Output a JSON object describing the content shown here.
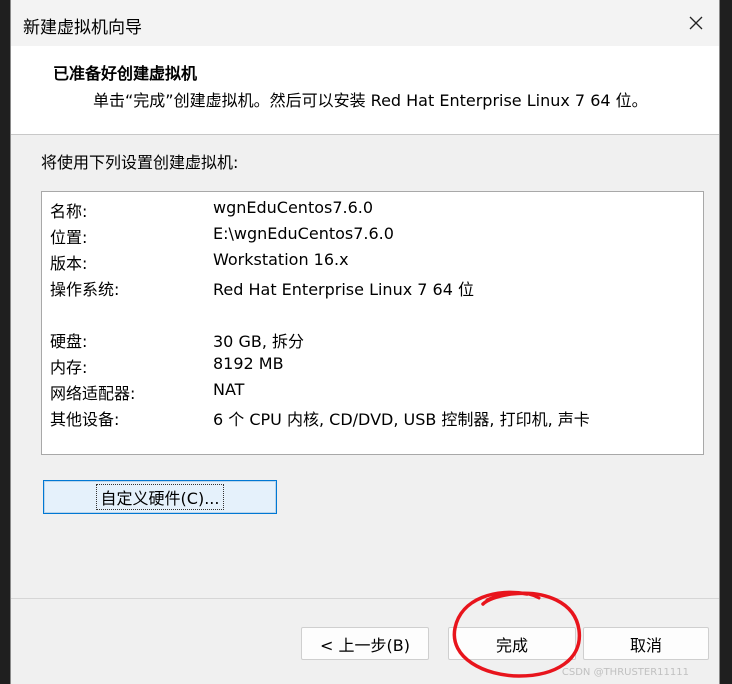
{
  "window": {
    "title": "新建虚拟机向导"
  },
  "header": {
    "title": "已准备好创建虚拟机",
    "subtitle": "单击“完成”创建虚拟机。然后可以安装 Red Hat Enterprise Linux 7 64 位。"
  },
  "main": {
    "settings_label": "将使用下列设置创建虚拟机:",
    "summary": [
      {
        "key": "名称:",
        "value": "wgnEduCentos7.6.0"
      },
      {
        "key": "位置:",
        "value": "E:\\wgnEduCentos7.6.0"
      },
      {
        "key": "版本:",
        "value": "Workstation 16.x"
      },
      {
        "key": "操作系统:",
        "value": "Red Hat Enterprise Linux 7 64 位"
      },
      {
        "key": "硬盘:",
        "value": "30 GB, 拆分"
      },
      {
        "key": "内存:",
        "value": "8192 MB"
      },
      {
        "key": "网络适配器:",
        "value": "NAT"
      },
      {
        "key": "其他设备:",
        "value": "6 个 CPU 内核, CD/DVD, USB 控制器, 打印机, 声卡"
      }
    ],
    "customize_label": "自定义硬件(C)..."
  },
  "footer": {
    "back_label": "< 上一步(B)",
    "finish_label": "完成",
    "cancel_label": "取消"
  },
  "colors": {
    "annotation_red": "#e8141c",
    "focus_blue": "#0078d4"
  },
  "watermark": "CSDN @THRUSTER11111"
}
